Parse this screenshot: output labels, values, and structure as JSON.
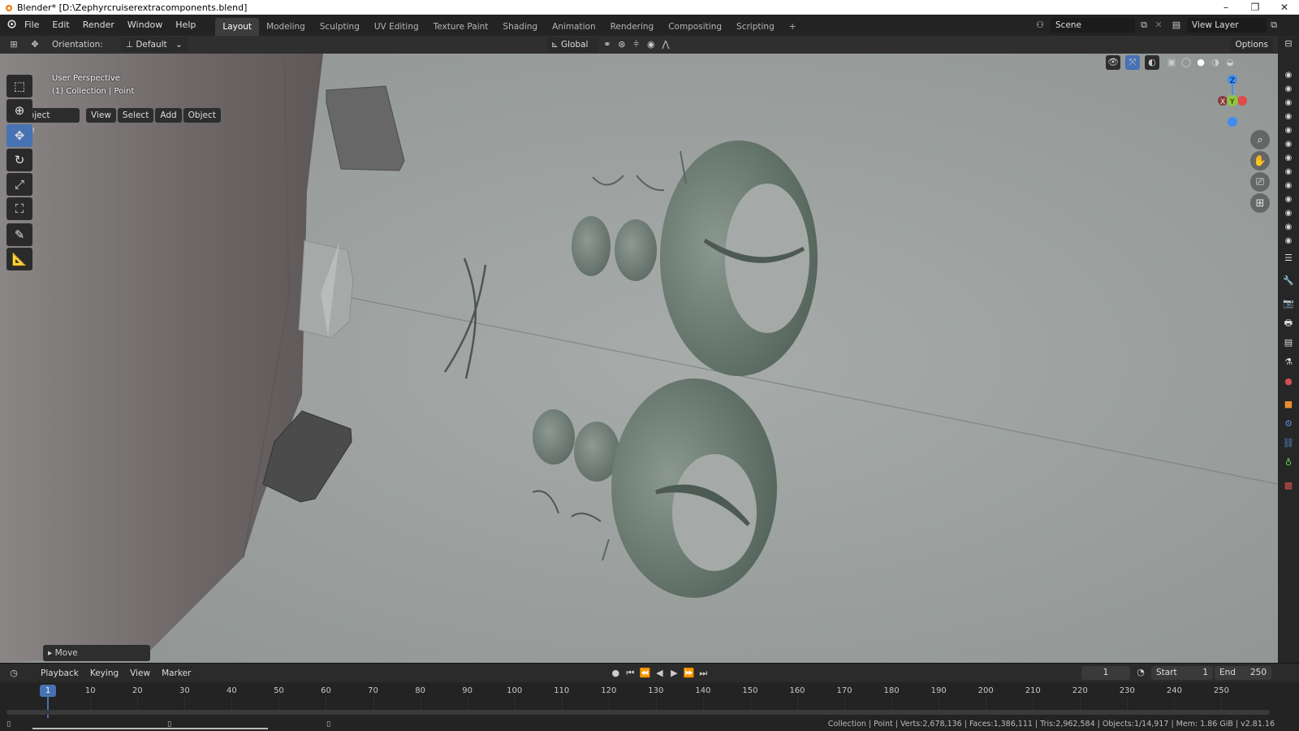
{
  "window": {
    "title": "Blender* [D:\\Zephyrcruiserextracomponents.blend]",
    "controls": [
      "–",
      "❐",
      "✕"
    ]
  },
  "menu": {
    "items": [
      "File",
      "Edit",
      "Render",
      "Window",
      "Help"
    ]
  },
  "workspaces": {
    "tabs": [
      "Layout",
      "Modeling",
      "Sculpting",
      "UV Editing",
      "Texture Paint",
      "Shading",
      "Animation",
      "Rendering",
      "Compositing",
      "Scripting"
    ],
    "add": "+"
  },
  "scene": {
    "name": "Scene",
    "view_layer": "View Layer"
  },
  "header": {
    "orientation_label": "Orientation:",
    "orientation_value": "Default",
    "transform_space": "Global",
    "options": "Options"
  },
  "viewport_header": {
    "mode": "Object Mode",
    "menus": [
      "View",
      "Select",
      "Add",
      "Object"
    ]
  },
  "viewport": {
    "perspective": "User Perspective",
    "collection": "(1) Collection | Point",
    "background": "#9ea3a2",
    "gizmo": {
      "z": "Z",
      "y": "Y",
      "x": "X"
    }
  },
  "operator_panel": {
    "label": "Move"
  },
  "timeline": {
    "menus": [
      "Playback",
      "Keying",
      "View",
      "Marker"
    ],
    "current_frame": "1",
    "start_label": "Start",
    "start": "1",
    "end_label": "End",
    "end": "250",
    "ticks": [
      "10",
      "20",
      "30",
      "40",
      "50",
      "60",
      "70",
      "80",
      "90",
      "100",
      "110",
      "120",
      "130",
      "140",
      "150",
      "160",
      "170",
      "180",
      "190",
      "200",
      "210",
      "220",
      "230",
      "240",
      "250"
    ],
    "marker": "1"
  },
  "status": {
    "text": "Collection | Point | Verts:2,678,136 | Faces:1,386,111 | Tris:2,962,584 | Objects:1/14,917 | Mem: 1.86 GiB | v2.81.16"
  },
  "colors": {
    "accent": "#4772b3",
    "axis_x": "#e04a4a",
    "axis_y": "#8ec63f",
    "axis_z": "#3d8ef0"
  }
}
